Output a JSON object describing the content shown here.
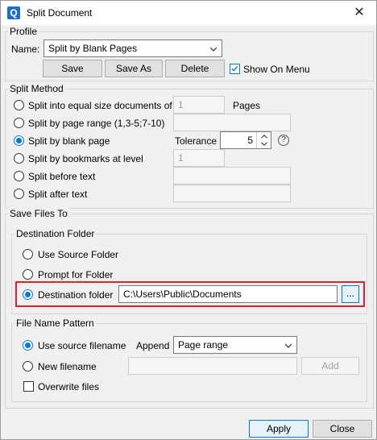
{
  "window": {
    "title": "Split Document",
    "app_icon": "Q"
  },
  "profile": {
    "legend": "Profile",
    "name_label": "Name:",
    "name_value": "Split by Blank Pages",
    "save_label": "Save",
    "save_as_label": "Save As",
    "delete_label": "Delete",
    "show_on_menu_label": "Show On Menu",
    "show_on_menu_checked": true
  },
  "split_method": {
    "legend": "Split Method",
    "options": [
      {
        "label": "Split into equal size documents of",
        "value": "1",
        "suffix": "Pages"
      },
      {
        "label": "Split by page range (1,3-5;7-10)",
        "value": ""
      },
      {
        "label": "Split by blank page",
        "tolerance_label": "Tolerance",
        "tolerance_value": "5"
      },
      {
        "label": "Split by bookmarks at level",
        "value": "1"
      },
      {
        "label": "Split before text",
        "value": ""
      },
      {
        "label": "Split after text",
        "value": ""
      }
    ],
    "selected": 2
  },
  "save_files_to": {
    "legend": "Save Files To",
    "destination": {
      "legend": "Destination Folder",
      "options": [
        {
          "label": "Use Source Folder"
        },
        {
          "label": "Prompt for Folder"
        },
        {
          "label": "Destination folder"
        }
      ],
      "path": "C:\\Users\\Public\\Documents",
      "browse_label": "..."
    },
    "pattern": {
      "legend": "File Name Pattern",
      "use_source_label": "Use source filename",
      "append_label": "Append",
      "append_value": "Page range",
      "new_filename_label": "New filename",
      "new_filename_value": "",
      "add_label": "Add",
      "overwrite_label": "Overwrite files"
    }
  },
  "footer": {
    "apply_label": "Apply",
    "close_label": "Close"
  },
  "colors": {
    "accent": "#0078d7",
    "highlight": "#e0202e"
  }
}
